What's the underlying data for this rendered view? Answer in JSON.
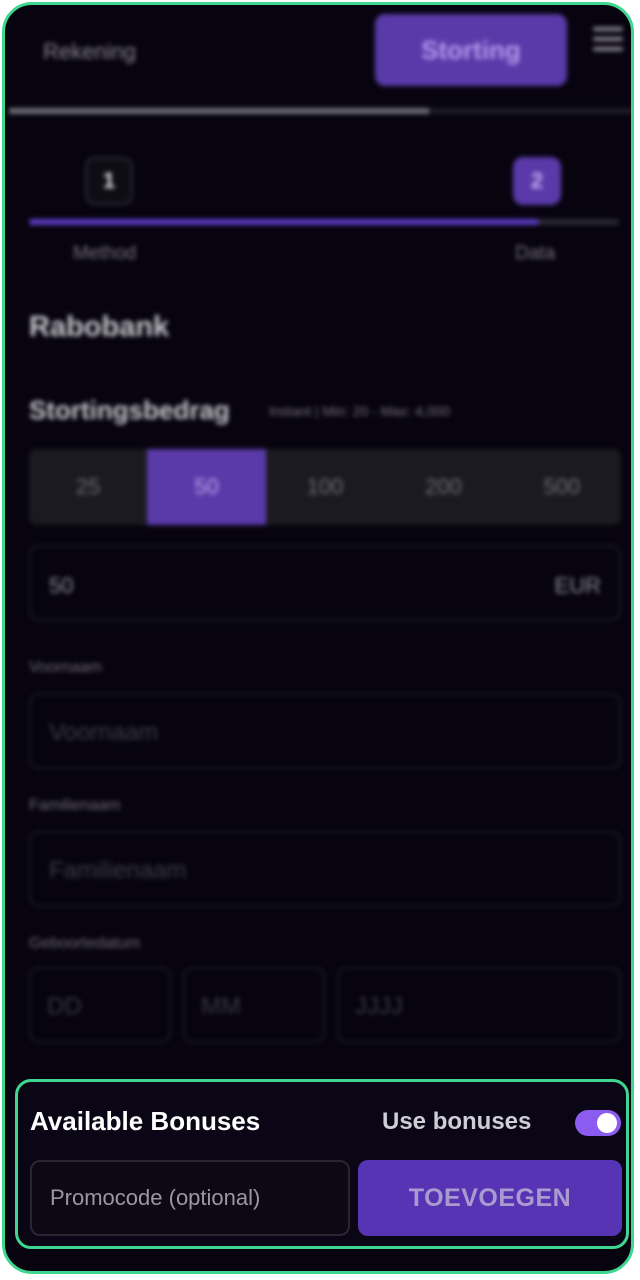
{
  "header": {
    "tab_label": "Rekening",
    "deposit_button": "Storting"
  },
  "progress": {
    "top_fraction": 0.67,
    "steps_fraction": 0.86
  },
  "steps": [
    {
      "number": "1",
      "label": "Method"
    },
    {
      "number": "2",
      "label": "Data"
    }
  ],
  "method": {
    "name": "Rabobank"
  },
  "amount": {
    "title": "Stortingsbedrag",
    "subtitle": "Instant | Min: 20 - Max: 4,000",
    "options": [
      "25",
      "50",
      "100",
      "200",
      "500"
    ],
    "selected": "50",
    "value": "50",
    "currency": "EUR"
  },
  "form": {
    "first_name_label": "Voornaam",
    "first_name_placeholder": "Voornaam",
    "last_name_label": "Familienaam",
    "last_name_placeholder": "Familienaam",
    "dob_label": "Geboortedatum",
    "dob_day": "DD",
    "dob_month": "MM",
    "dob_year": "JJJJ"
  },
  "bonus": {
    "title": "Available Bonuses",
    "use_label": "Use bonuses",
    "use_enabled": true,
    "promo_placeholder": "Promocode (optional)",
    "add_button": "TOEVOEGEN"
  },
  "colors": {
    "accent": "#5a3aa8",
    "highlight_border": "#3fd68f",
    "background": "#07040f",
    "toggle_on": "#8c5cf0"
  }
}
